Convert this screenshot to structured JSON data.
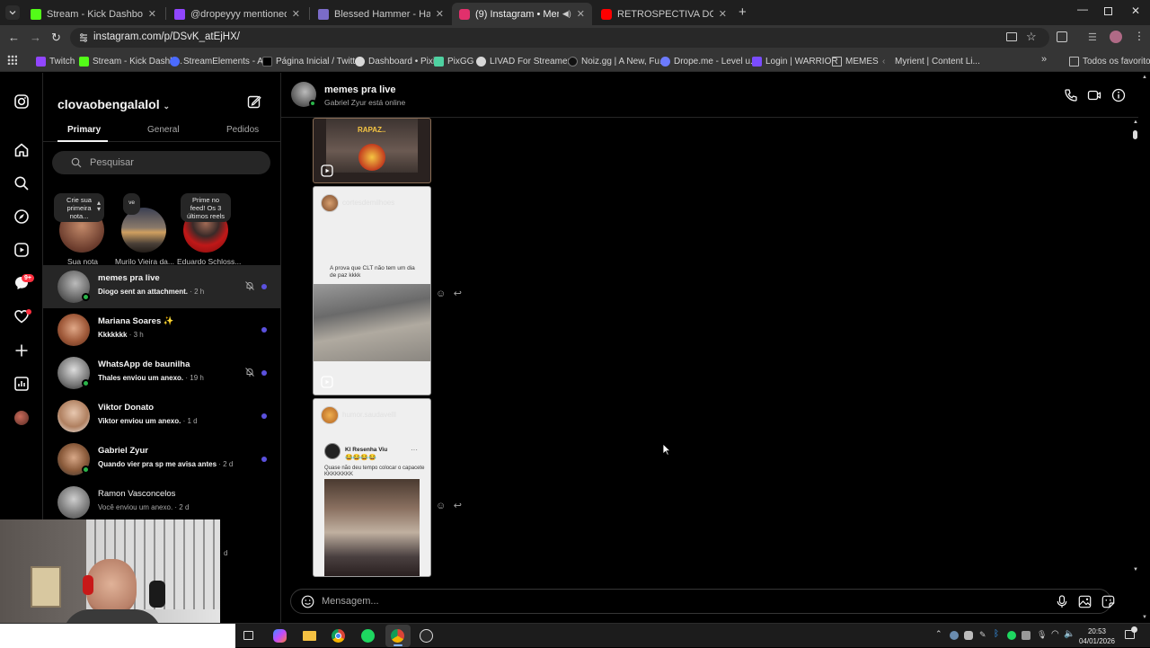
{
  "browser": {
    "tabs": [
      {
        "label": "Stream - Kick Dashboard",
        "color": "#53fc18"
      },
      {
        "label": "@dropeyyy mentioned you",
        "color": "#9146ff"
      },
      {
        "label": "Blessed Hammer - Hammerkun",
        "color": "#7b6cc9"
      },
      {
        "label": "(9) Instagram • Mensagens",
        "color": "#e1306c"
      },
      {
        "label": "RETROSPECTIVA DO FUTEBOL",
        "color": "#ff0000"
      }
    ],
    "url": "instagram.com/p/DSvK_atEjHX/",
    "bookmarks": [
      {
        "label": "Twitch",
        "color": "#9146ff"
      },
      {
        "label": "Stream - Kick Dashb...",
        "color": "#53fc18"
      },
      {
        "label": "StreamElements - A...",
        "color": "#4b6bff"
      },
      {
        "label": "Página Inicial / Twitter",
        "color": "#cccccc"
      },
      {
        "label": "Dashboard • Pixie",
        "color": "#d8d8d8"
      },
      {
        "label": "PixGG",
        "color": "#4fd1a1"
      },
      {
        "label": "LIVAD For Streamer...",
        "color": "#d8d8d8"
      },
      {
        "label": "Noiz.gg | A New, Fu...",
        "color": "#111111"
      },
      {
        "label": "Drope.me - Level u...",
        "color": "#6d7bff"
      },
      {
        "label": "Login | WARRIOR",
        "color": "#7a4cff"
      },
      {
        "label": "MEMES",
        "color": "#bdbdbd"
      },
      {
        "label": "Myrient | Content Li...",
        "color": "#888888"
      }
    ],
    "all_bookmarks": "Todos os favoritos"
  },
  "instagram": {
    "rail_badge": "9+",
    "account": "clovaobengalalol",
    "dm_tabs": [
      "Primary",
      "General",
      "Pedidos"
    ],
    "search_placeholder": "Pesquisar",
    "notes": [
      {
        "bubble": "Crie sua primeira nota...",
        "name": "Sua nota"
      },
      {
        "bubble": "ve",
        "name": "Murilo Vieira da..."
      },
      {
        "bubble": "Prime no feed! Os 3 últimos reels",
        "name": "Eduardo Schloss..."
      }
    ],
    "conversations": [
      {
        "name": "memes pra live",
        "preview": "Diogo sent an attachment.",
        "time": "· 2 h",
        "unread": true,
        "muted": true,
        "online": true
      },
      {
        "name": "Mariana Soares ✨",
        "preview": "Kkkkkkk",
        "time": "· 3 h",
        "unread": true,
        "muted": false,
        "online": false
      },
      {
        "name": "WhatsApp de baunilha",
        "preview": "Thales enviou um anexo.",
        "time": "· 19 h",
        "unread": true,
        "muted": true,
        "online": true
      },
      {
        "name": "Viktor Donato",
        "preview": "Viktor enviou um anexo.",
        "time": "· 1 d",
        "unread": true,
        "muted": false,
        "online": false
      },
      {
        "name": "Gabriel Zyur",
        "preview": "Quando vier pra sp me avisa antes",
        "time": "· 2 d",
        "unread": true,
        "muted": false,
        "online": true
      },
      {
        "name": "Ramon Vasconcelos",
        "preview": "Você enviou um anexo.",
        "time": "· 2 d",
        "unread": false,
        "muted": false,
        "online": false
      }
    ],
    "hidden_time": "d",
    "chat": {
      "title": "memes pra live",
      "status": "Gabriel Zyur está online",
      "posts": [
        {
          "caption": "RAPAZ..",
          "user": ""
        },
        {
          "caption": "A prova que CLT não tem um dia de paz kkkk",
          "user": "cortesdemilhoes"
        },
        {
          "caption": "Quase não deu tempo colocar o capacete KKKKKKKK",
          "user": "humor.saudavelll",
          "inner_user": "Kl Resenha Viu",
          "inner_emoji": "😂😂😂😂"
        }
      ],
      "message_placeholder": "Mensagem..."
    }
  },
  "taskbar": {
    "time": "20:53",
    "date": "04/01/2026"
  }
}
